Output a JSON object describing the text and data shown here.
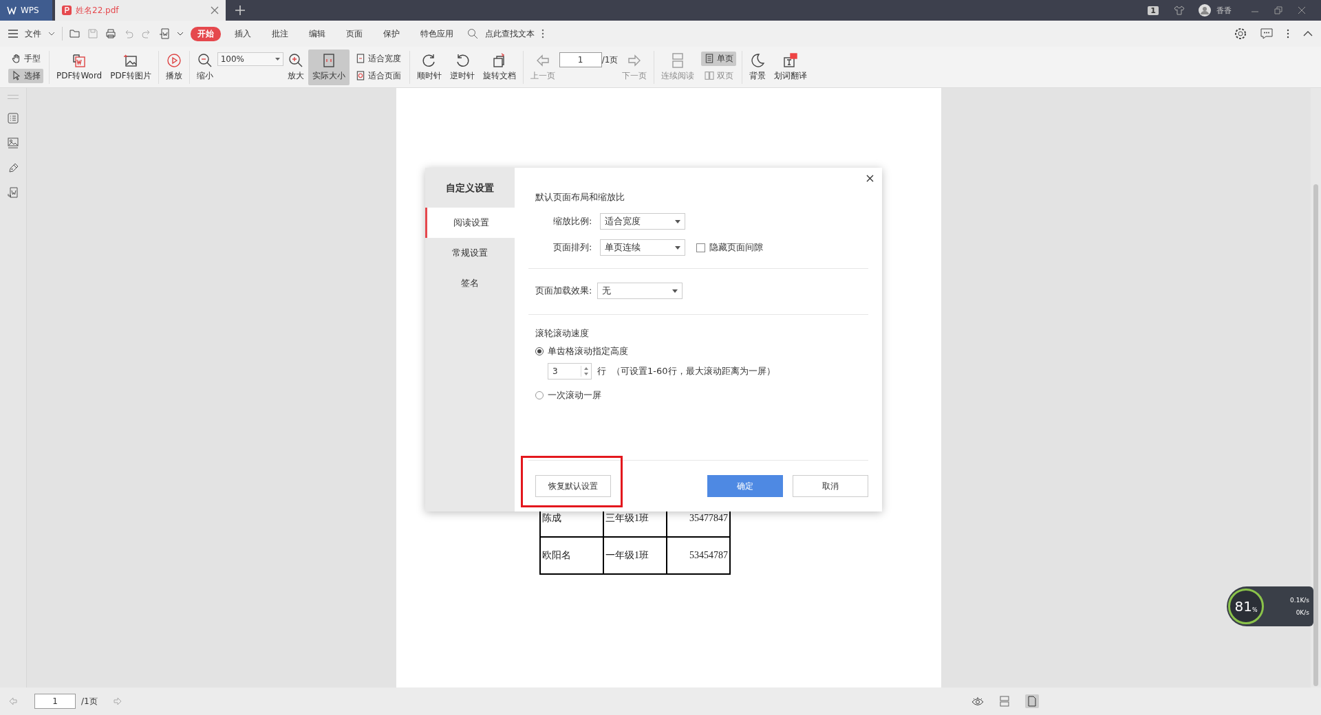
{
  "tabs": [
    {
      "label": "WPS",
      "kind": "app",
      "selected": false
    },
    {
      "label": "姓名22.pdf",
      "kind": "doc",
      "selected": true
    }
  ],
  "title_bar": {
    "badge": "1",
    "user": "香香"
  },
  "menu": {
    "file": "文件",
    "tabs": [
      {
        "label": "开始",
        "selected": true
      },
      {
        "label": "插入",
        "selected": false
      },
      {
        "label": "批注",
        "selected": false
      },
      {
        "label": "编辑",
        "selected": false
      },
      {
        "label": "页面",
        "selected": false
      },
      {
        "label": "保护",
        "selected": false
      },
      {
        "label": "特色应用",
        "selected": false
      }
    ],
    "search": "点此查找文本"
  },
  "toolbar": [
    {
      "kind": "stack",
      "items": [
        {
          "label": "手型",
          "selected": false,
          "disabled": false
        },
        {
          "label": "选择",
          "selected": true,
          "disabled": false
        }
      ]
    },
    {
      "kind": "button",
      "label": "PDF转Word",
      "selected": false,
      "disabled": false
    },
    {
      "kind": "button",
      "label": "PDF转图片",
      "selected": false,
      "disabled": false
    },
    {
      "kind": "button",
      "label": "播放",
      "selected": false,
      "disabled": false
    },
    {
      "kind": "button",
      "label": "缩小",
      "selected": false,
      "disabled": false
    },
    {
      "kind": "zoom",
      "value": "100%"
    },
    {
      "kind": "button",
      "label": "放大",
      "selected": false,
      "disabled": false
    },
    {
      "kind": "button",
      "label": "实际大小",
      "selected": true,
      "disabled": false
    },
    {
      "kind": "stack",
      "items": [
        {
          "label": "适合宽度",
          "selected": false,
          "disabled": false
        },
        {
          "label": "适合页面",
          "selected": false,
          "disabled": false
        }
      ]
    },
    {
      "kind": "button",
      "label": "顺时针",
      "selected": false,
      "disabled": false
    },
    {
      "kind": "button",
      "label": "逆时针",
      "selected": false,
      "disabled": false
    },
    {
      "kind": "button",
      "label": "旋转文档",
      "selected": false,
      "disabled": false
    },
    {
      "kind": "button",
      "label": "上一页",
      "selected": false,
      "disabled": true
    },
    {
      "kind": "page",
      "value": "1",
      "total": "/1页"
    },
    {
      "kind": "button",
      "label": "下一页",
      "selected": false,
      "disabled": true
    },
    {
      "kind": "button",
      "label": "连续阅读",
      "selected": false,
      "disabled": true
    },
    {
      "kind": "stack",
      "items": [
        {
          "label": "单页",
          "selected": true,
          "disabled": false
        },
        {
          "label": "双页",
          "selected": false,
          "disabled": true
        }
      ]
    },
    {
      "kind": "button",
      "label": "背景",
      "selected": false,
      "disabled": false
    },
    {
      "kind": "button",
      "label": "划词翻译",
      "selected": false,
      "disabled": false
    }
  ],
  "document": {
    "rows": [
      [
        "陈成",
        "三年级1班",
        "35477847"
      ],
      [
        "欧阳名",
        "一年级1班",
        "53454787"
      ]
    ]
  },
  "dialog": {
    "title": "自定义设置",
    "nav": [
      {
        "label": "阅读设置",
        "selected": true
      },
      {
        "label": "常规设置",
        "selected": false
      },
      {
        "label": "签名",
        "selected": false
      }
    ],
    "section_title": "默认页面布局和缩放比",
    "zoom": {
      "label": "缩放比例:",
      "value": "适合宽度"
    },
    "layout": {
      "label": "页面排列:",
      "value": "单页连续"
    },
    "hide_gap": {
      "label": "隐藏页面间隙",
      "checked": false
    },
    "load_effect": {
      "label": "页面加载效果:",
      "value": "无"
    },
    "scroll_title": "滚轮滚动速度",
    "scroll_options": [
      {
        "label": "单齿格滚动指定高度",
        "selected": true
      },
      {
        "label": "一次滚动一屏",
        "selected": false
      }
    ],
    "lines": {
      "value": "3",
      "unit": "行",
      "hint": "（可设置1-60行，最大滚动距离为一屏）"
    },
    "restore": "恢复默认设置",
    "ok": "确定",
    "cancel": "取消"
  },
  "status_bar": {
    "page": "1",
    "total": "/1页"
  },
  "speed_widget": {
    "percent": "81",
    "unit": "%",
    "up": "0.1K/s",
    "down": "0K/s"
  }
}
